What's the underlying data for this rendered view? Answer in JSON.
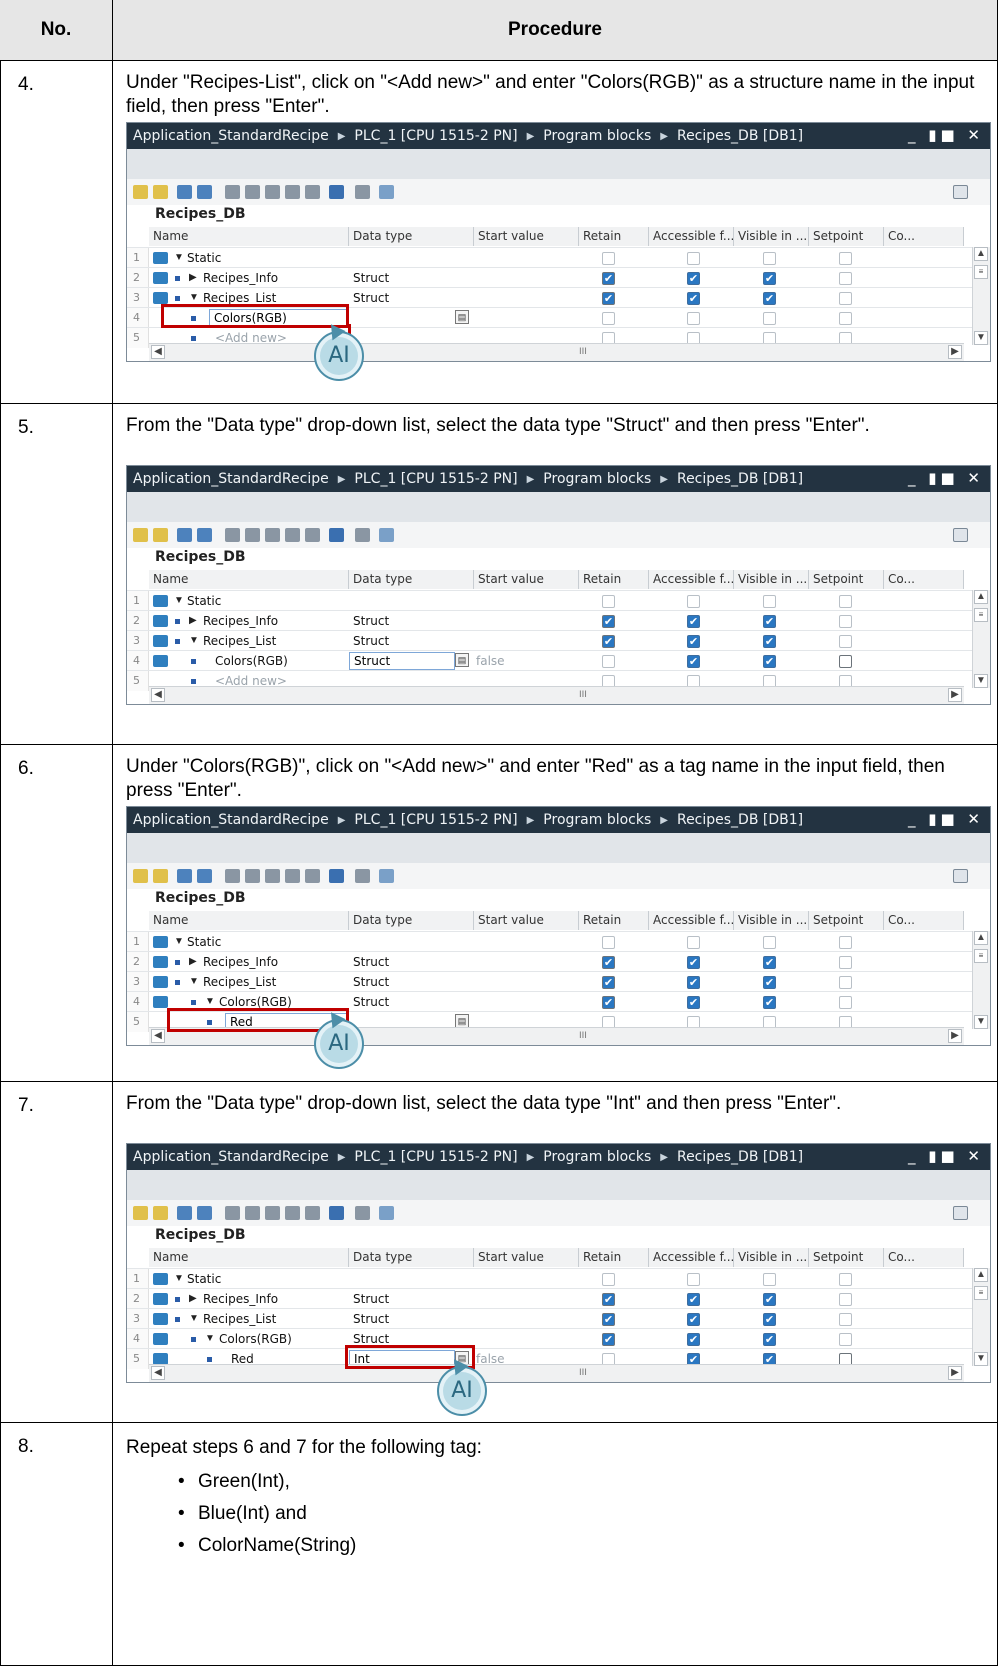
{
  "header": {
    "col_no": "No.",
    "col_procedure": "Procedure"
  },
  "window": {
    "breadcrumb": [
      "Application_StandardRecipe",
      "PLC_1 [CPU 1515-2 PN]",
      "Program blocks",
      "Recipes_DB [DB1]"
    ],
    "controls": "_ ▮■ ✕",
    "db_name": "Recipes_DB",
    "columns": [
      "Name",
      "Data type",
      "Start value",
      "Retain",
      "Accessible f...",
      "Visible in ...",
      "Setpoint",
      "Co..."
    ],
    "scroll_mark": "III"
  },
  "steps": [
    {
      "no": "4.",
      "text": "Under \"Recipes-List\", click on \"<Add new>\" and enter \"Colors(RGB)\" as a structure name in the input field, then press \"Enter\".",
      "rows": [
        {
          "n": "1",
          "name": "Static",
          "type": ""
        },
        {
          "n": "2",
          "name": "Recipes_Info",
          "type": "Struct"
        },
        {
          "n": "3",
          "name": "Recipes_List",
          "type": "Struct"
        },
        {
          "n": "4",
          "name": "Colors(RGB)",
          "type": ""
        },
        {
          "n": "5",
          "name": "<Add new>",
          "type": ""
        }
      ]
    },
    {
      "no": "5.",
      "text": "From the \"Data type\" drop-down list, select the data type \"Struct\" and then press \"Enter\".",
      "rows": [
        {
          "n": "1",
          "name": "Static",
          "type": ""
        },
        {
          "n": "2",
          "name": "Recipes_Info",
          "type": "Struct"
        },
        {
          "n": "3",
          "name": "Recipes_List",
          "type": "Struct"
        },
        {
          "n": "4",
          "name": "Colors(RGB)",
          "type": "Struct",
          "start": "false"
        },
        {
          "n": "5",
          "name": "<Add new>",
          "type": ""
        }
      ]
    },
    {
      "no": "6.",
      "text": "Under \"Colors(RGB)\", click on \"<Add new>\" and enter \"Red\" as a tag name in the input field, then press \"Enter\".",
      "rows": [
        {
          "n": "1",
          "name": "Static",
          "type": ""
        },
        {
          "n": "2",
          "name": "Recipes_Info",
          "type": "Struct"
        },
        {
          "n": "3",
          "name": "Recipes_List",
          "type": "Struct"
        },
        {
          "n": "4",
          "name": "Colors(RGB)",
          "type": "Struct"
        },
        {
          "n": "5",
          "name": "Red",
          "type": ""
        }
      ]
    },
    {
      "no": "7.",
      "text": "From the \"Data type\" drop-down list, select the data type \"Int\" and then press \"Enter\".",
      "rows": [
        {
          "n": "1",
          "name": "Static",
          "type": ""
        },
        {
          "n": "2",
          "name": "Recipes_Info",
          "type": "Struct"
        },
        {
          "n": "3",
          "name": "Recipes_List",
          "type": "Struct"
        },
        {
          "n": "4",
          "name": "Colors(RGB)",
          "type": "Struct"
        },
        {
          "n": "5",
          "name": "Red",
          "type": "Int",
          "start": "false"
        }
      ]
    }
  ],
  "step8": {
    "no": "8.",
    "text": "Repeat steps 6 and 7 for the following tag:",
    "bullets": [
      "Green(Int),",
      "Blue(Int) and",
      "ColorName(String)"
    ]
  },
  "cursor_label": "AI"
}
